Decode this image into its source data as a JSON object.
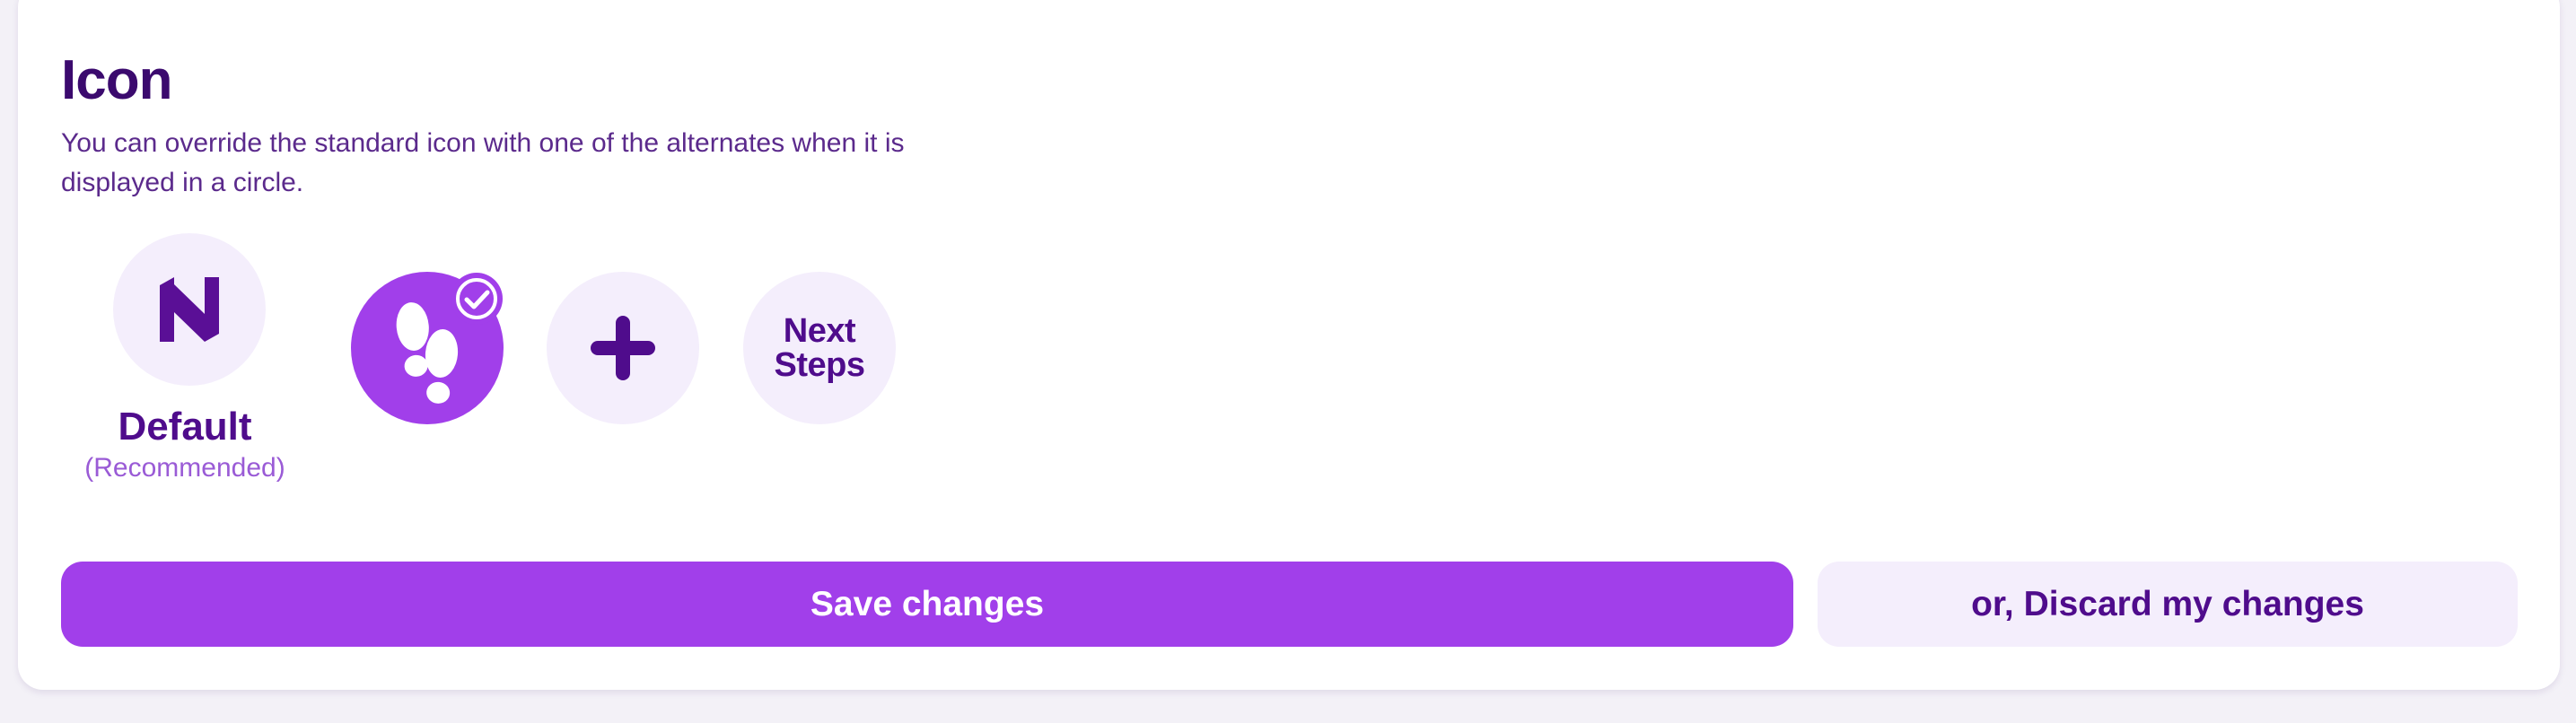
{
  "section": {
    "title": "Icon",
    "description": "You can override the standard icon with one of the alternates when it is displayed in a circle."
  },
  "icon_options": [
    {
      "name": "default",
      "icon": "brand-logo-icon",
      "label": "Default",
      "sublabel": "(Recommended)",
      "selected": false
    },
    {
      "name": "footprints",
      "icon": "footprints-icon",
      "selected": true
    },
    {
      "name": "plus",
      "icon": "plus-icon",
      "selected": false
    },
    {
      "name": "next-steps",
      "text_line1": "Next",
      "text_line2": "Steps",
      "selected": false
    }
  ],
  "actions": {
    "save_label": "Save changes",
    "discard_label": "or, Discard my changes"
  },
  "colors": {
    "accent": "#a13fea",
    "deep_purple": "#4f0c8c",
    "heading": "#3b0a6e",
    "soft_bg": "#f4eefc"
  }
}
